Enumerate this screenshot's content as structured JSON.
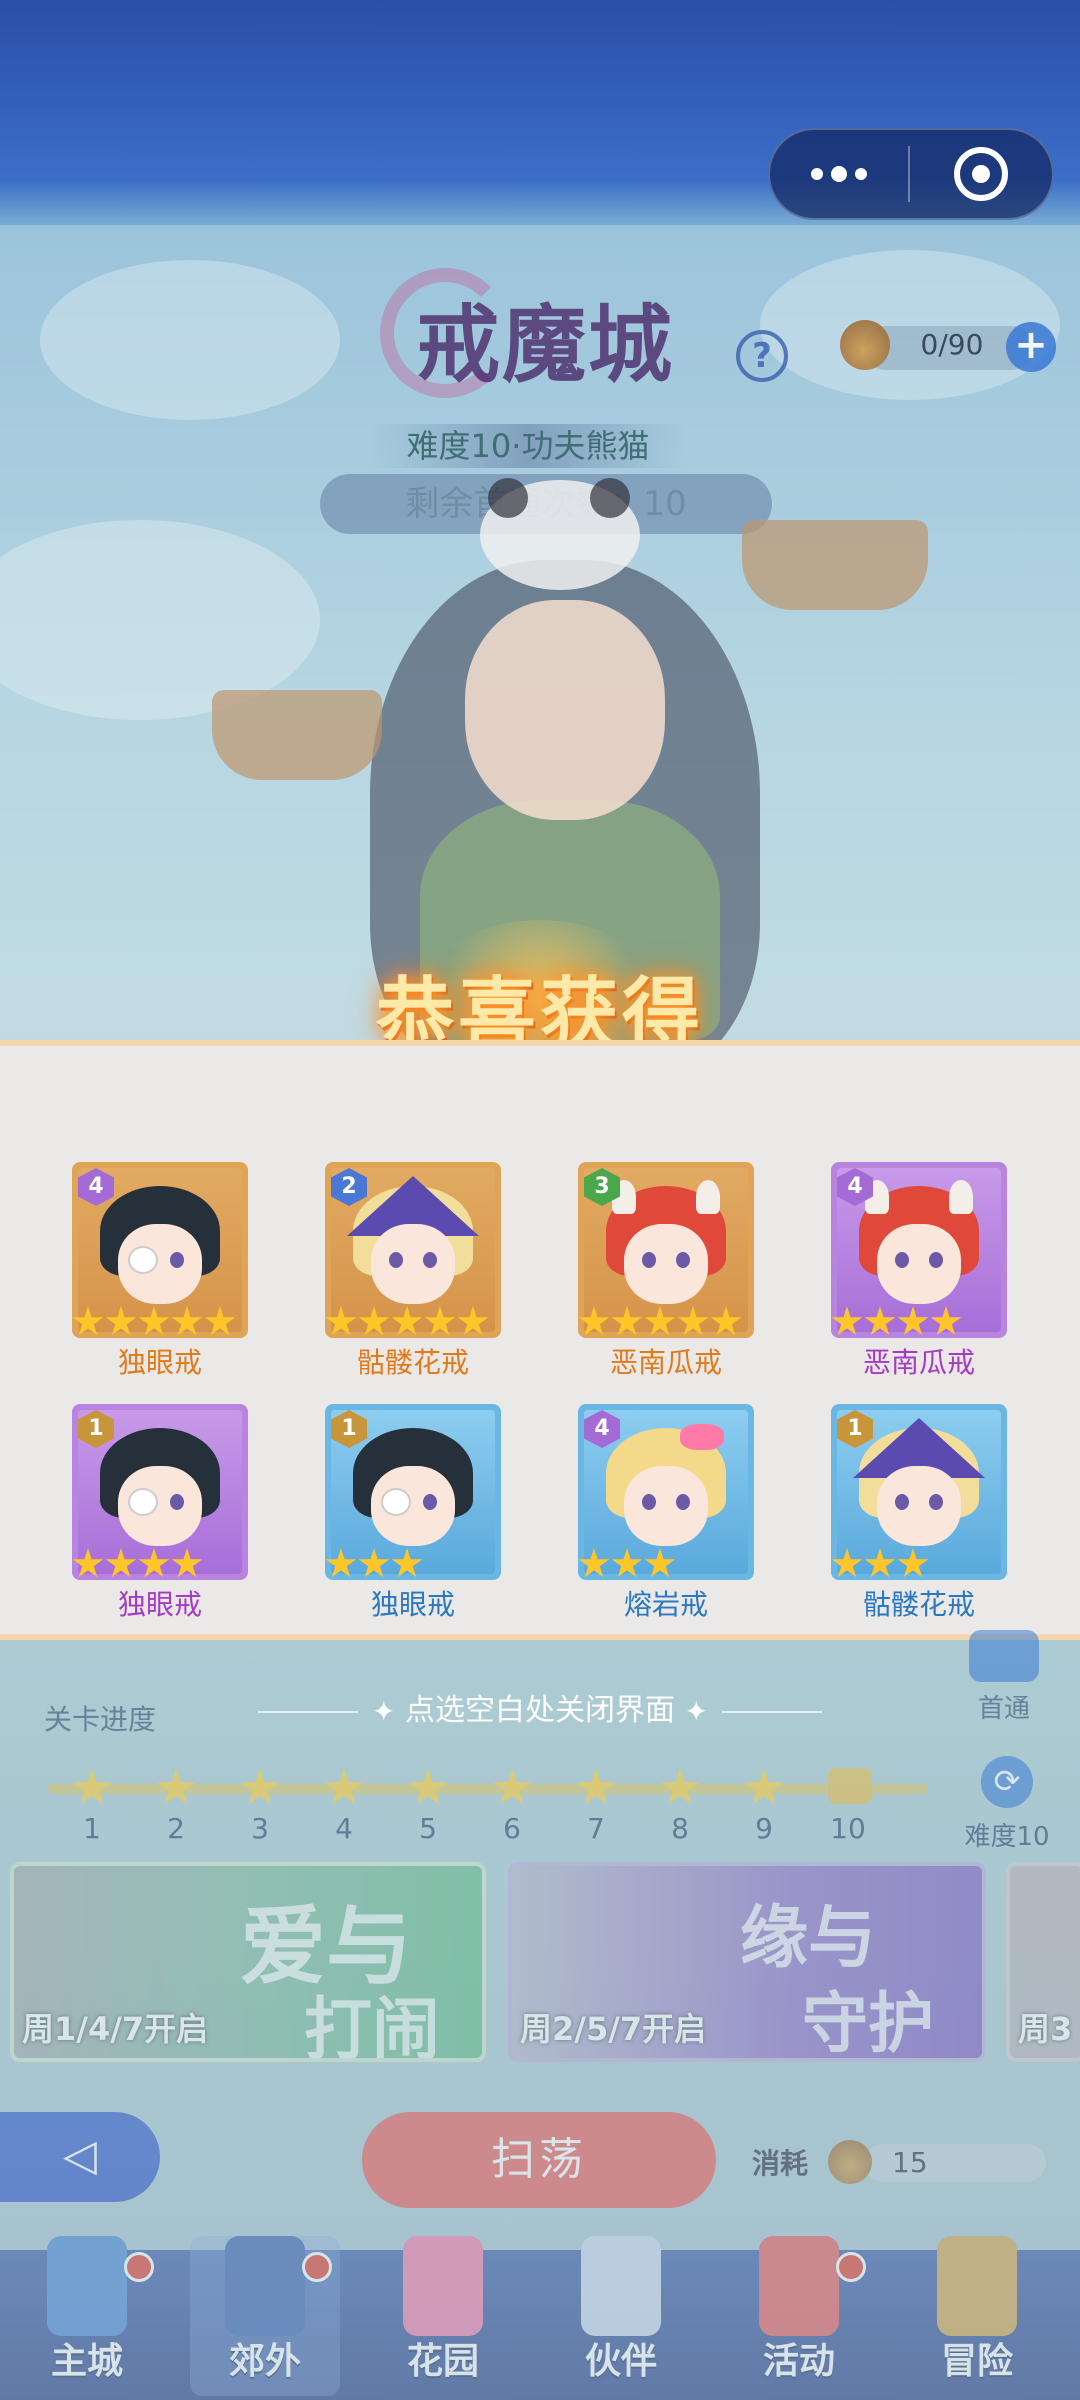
{
  "topbar": {
    "menu_icon": "more-dots-icon",
    "target_icon": "target-circle-icon"
  },
  "dungeon": {
    "title": "戒魔城",
    "help_icon": "help-icon",
    "stamina": {
      "value": "0/90",
      "icon": "bun-icon",
      "add_icon": "plus-icon"
    },
    "difficulty": "难度10·功夫熊猫",
    "clears_remaining": "剩余首通次数：10"
  },
  "reward": {
    "title": "恭喜获得",
    "items": [
      {
        "name": "独眼戒",
        "level": "4",
        "stars": 5,
        "frame": "gold",
        "label_color": "orange",
        "avatar": "eyepatch-girl"
      },
      {
        "name": "骷髅花戒",
        "level": "2",
        "stars": 5,
        "frame": "gold",
        "label_color": "orange",
        "avatar": "witch-girl"
      },
      {
        "name": "恶南瓜戒",
        "level": "3",
        "stars": 5,
        "frame": "gold",
        "label_color": "orange",
        "avatar": "horned-girl"
      },
      {
        "name": "恶南瓜戒",
        "level": "4",
        "stars": 4,
        "frame": "purple",
        "label_color": "purple",
        "avatar": "horned-girl"
      },
      {
        "name": "独眼戒",
        "level": "1",
        "stars": 4,
        "frame": "purple",
        "label_color": "purple",
        "avatar": "eyepatch-girl"
      },
      {
        "name": "独眼戒",
        "level": "1",
        "stars": 3,
        "frame": "blue",
        "label_color": "blue",
        "avatar": "eyepatch-girl"
      },
      {
        "name": "熔岩戒",
        "level": "4",
        "stars": 3,
        "frame": "blue",
        "label_color": "blue",
        "avatar": "blonde-bow-girl"
      },
      {
        "name": "骷髅花戒",
        "level": "1",
        "stars": 3,
        "frame": "blue",
        "label_color": "blue",
        "avatar": "witch-girl"
      }
    ],
    "close_hint": "点选空白处关闭界面"
  },
  "progress": {
    "label": "关卡进度",
    "first_clear": "首通",
    "stages": [
      "1",
      "2",
      "3",
      "4",
      "5",
      "6",
      "7",
      "8",
      "9",
      "10"
    ],
    "difficulty_button": "难度10"
  },
  "banners": [
    {
      "line1": "爱与",
      "line2": "打闹",
      "schedule": "周1/4/7开启"
    },
    {
      "line1": "缘与",
      "line2": "守护",
      "schedule": "周2/5/7开启"
    },
    {
      "schedule": "周3"
    }
  ],
  "actions": {
    "back_icon": "back-arrow-icon",
    "sweep": "扫荡",
    "cost_label": "消耗",
    "cost_value": "15"
  },
  "nav": [
    {
      "label": "主城",
      "icon": "castle-icon",
      "badge": true
    },
    {
      "label": "郊外",
      "icon": "portal-icon",
      "badge": true,
      "active": true
    },
    {
      "label": "花园",
      "icon": "heart-icon",
      "badge": false
    },
    {
      "label": "伙伴",
      "icon": "partner-icon",
      "badge": false
    },
    {
      "label": "活动",
      "icon": "gift-icon",
      "badge": true
    },
    {
      "label": "冒险",
      "icon": "compass-icon",
      "badge": false
    }
  ],
  "colors": {
    "frame_gold": "#e0a457",
    "frame_purple": "#b984e0",
    "frame_blue": "#6bb7e3",
    "sweep_button": "#ec5a57",
    "nav_bg": "#2a3f86"
  }
}
